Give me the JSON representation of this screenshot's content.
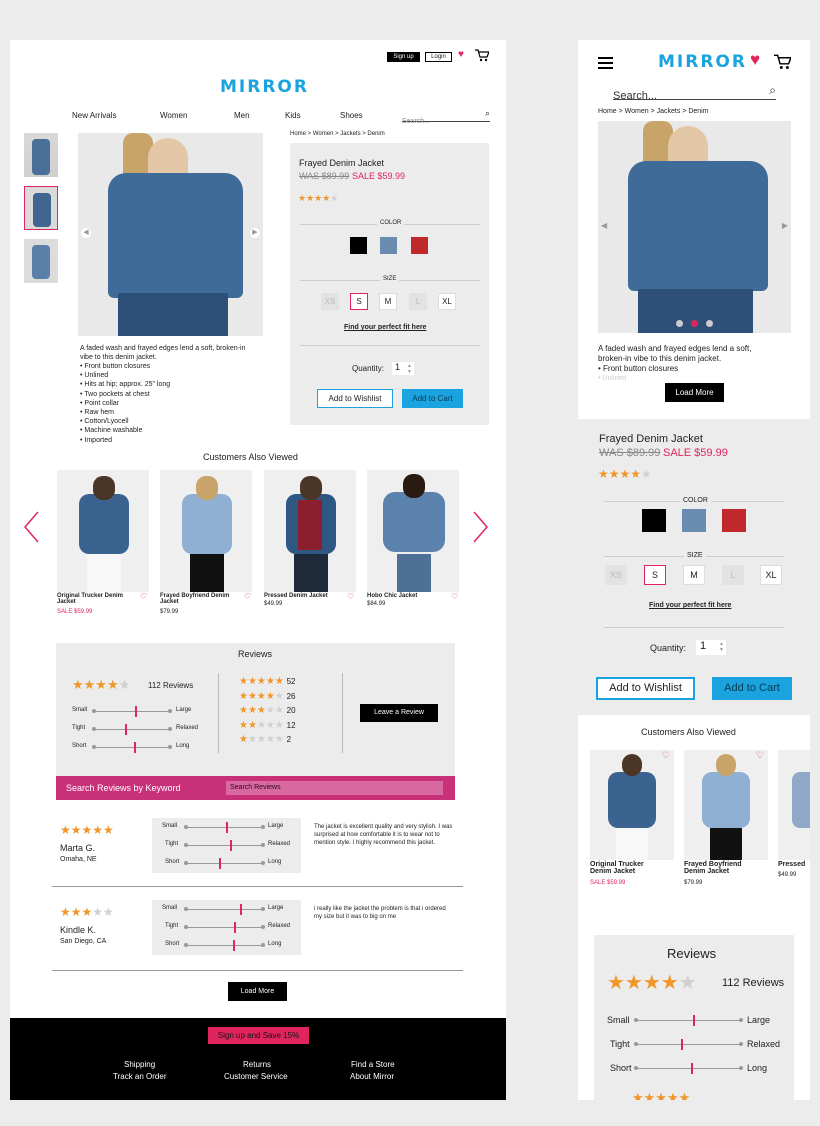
{
  "brand": "MIRROR",
  "header": {
    "signup": "Sign up",
    "login": "Login"
  },
  "nav": [
    "New Arrivals",
    "Women",
    "Men",
    "Kids",
    "Shoes"
  ],
  "search_placeholder": "Search...",
  "breadcrumb": "Home > Women > Jackets > Denim",
  "product": {
    "name": "Frayed Denim Jacket",
    "was": "WAS $89.99",
    "sale": "SALE $59.99",
    "rating": 4,
    "color_label": "COLOR",
    "colors": [
      "#000000",
      "#6a8cb0",
      "#c0282b"
    ],
    "size_label": "SIZE",
    "sizes": [
      "XS",
      "S",
      "M",
      "L",
      "XL"
    ],
    "fit_link": "Find your perfect fit here",
    "quantity_label": "Quantity:",
    "quantity": "1",
    "wishlist": "Add to Wishlist",
    "cart": "Add to Cart",
    "description": "A faded wash and frayed edges lend a soft, broken-in vibe to this denim jacket.",
    "bullets": [
      "Front button closures",
      "Unlined",
      "Hits at hip; approx. 25\" long",
      "Two pockets at chest",
      "Point collar",
      "Raw hem",
      "Cotton/Lyocell",
      "Machine washable",
      "Imported"
    ]
  },
  "also_viewed": {
    "title": "Customers Also Viewed",
    "items": [
      {
        "name": "Original Trucker Denim Jacket",
        "price": "SALE $59.99"
      },
      {
        "name": "Frayed Boyfriend Denim Jacket",
        "price": "$79.99"
      },
      {
        "name": "Pressed Denim Jacket",
        "price": "$49.99"
      },
      {
        "name": "Hobo Chic Jacket",
        "price": "$84.99"
      }
    ]
  },
  "reviews": {
    "title": "Reviews",
    "count": "112 Reviews",
    "rating": 4,
    "fit": [
      {
        "l": "Small",
        "r": "Large",
        "v": 0.45
      },
      {
        "l": "Tight",
        "r": "Relaxed",
        "v": 0.35
      },
      {
        "l": "Short",
        "r": "Long",
        "v": 0.45
      }
    ],
    "bars": [
      {
        "stars": 5,
        "n": "52"
      },
      {
        "stars": 4,
        "n": "26"
      },
      {
        "stars": 3,
        "n": "20"
      },
      {
        "stars": 2,
        "n": "12"
      },
      {
        "stars": 1,
        "n": "2"
      }
    ],
    "leave": "Leave a Review",
    "search_title": "Search Reviews by Keyword",
    "search_placeholder": "Search Reviews",
    "list": [
      {
        "name": "Marta G.",
        "loc": "Omaha, NE",
        "stars": 5,
        "text": "The jacket is excellent quality and very stylish. I was surprised at how comfortable it is to wear not to mention style. I highly recommend this jacket.",
        "fit": [
          0.45,
          0.5,
          0.4
        ]
      },
      {
        "name": "Kindle K.",
        "loc": "San Diego, CA",
        "stars": 3,
        "text": "i really like the jacket the problem is that i ordered my size but it was to big on me",
        "fit": [
          0.55,
          0.6,
          0.55
        ]
      }
    ],
    "load_more": "Load More"
  },
  "footer": {
    "promo": "Sign up and Save 15%",
    "links": [
      "Shipping",
      "Returns",
      "Find a Store",
      "Track an Order",
      "Customer Service",
      "About Mirror"
    ]
  },
  "mobile": {
    "load_more": "Load More",
    "bullets_visible": [
      "Front button closures",
      "Unlined"
    ],
    "item3_name": "Pressed",
    "item3_price": "$49.99"
  }
}
